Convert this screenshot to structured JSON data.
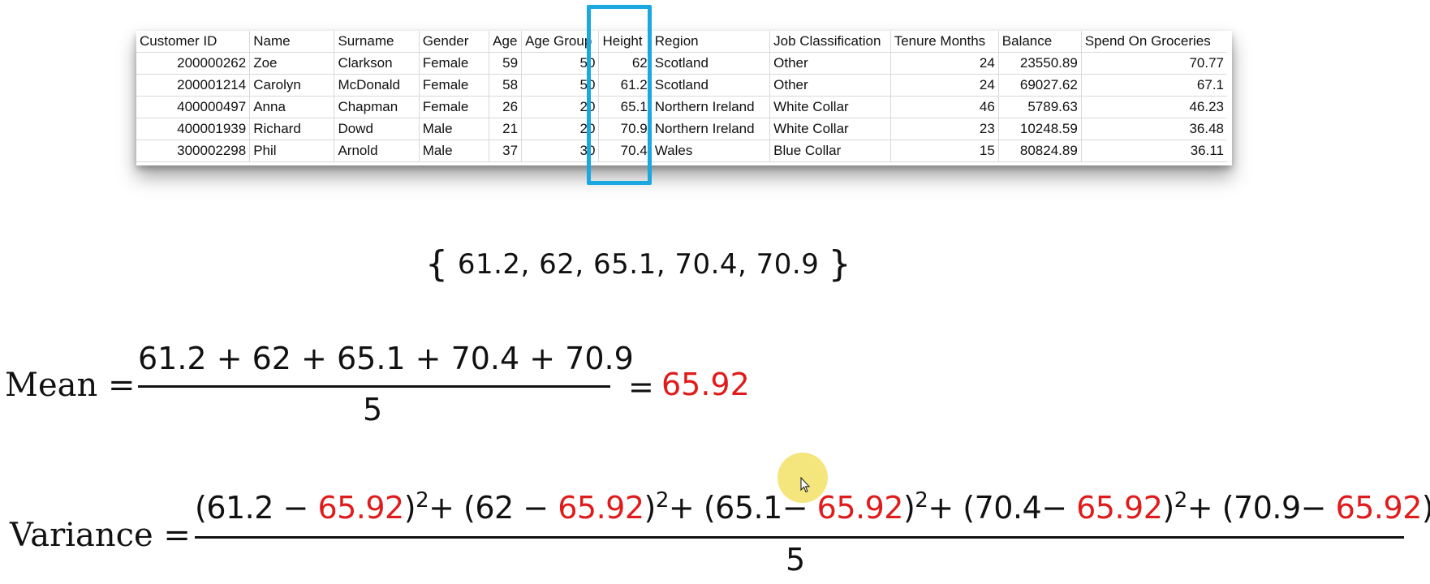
{
  "table": {
    "headers": [
      "Customer ID",
      "Name",
      "Surname",
      "Gender",
      "Age",
      "Age Group",
      "Height",
      "Region",
      "Job Classification",
      "Tenure Months",
      "Balance",
      "Spend On Groceries"
    ],
    "rows": [
      [
        "200000262",
        "Zoe",
        "Clarkson",
        "Female",
        "59",
        "50",
        "62",
        "Scotland",
        "Other",
        "24",
        "23550.89",
        "70.77"
      ],
      [
        "200001214",
        "Carolyn",
        "McDonald",
        "Female",
        "58",
        "50",
        "61.2",
        "Scotland",
        "Other",
        "24",
        "69027.62",
        "67.1"
      ],
      [
        "400000497",
        "Anna",
        "Chapman",
        "Female",
        "26",
        "20",
        "65.1",
        "Northern Ireland",
        "White Collar",
        "46",
        "5789.63",
        "46.23"
      ],
      [
        "400001939",
        "Richard",
        "Dowd",
        "Male",
        "21",
        "20",
        "70.9",
        "Northern Ireland",
        "White Collar",
        "23",
        "10248.59",
        "36.48"
      ],
      [
        "300002298",
        "Phil",
        "Arnold",
        "Male",
        "37",
        "30",
        "70.4",
        "Wales",
        "Blue Collar",
        "15",
        "80824.89",
        "36.11"
      ]
    ]
  },
  "set": {
    "open": "{",
    "values": "61.2, 62, 65.1, 70.4, 70.9",
    "close": "}"
  },
  "mean": {
    "label": "Mean =",
    "numerator": "61.2 + 62 + 65.1 + 70.4 + 70.9",
    "denominator": "5",
    "equals": "=",
    "result": "65.92"
  },
  "variance": {
    "label": "Variance =",
    "terms": [
      {
        "open": "(61.2 − ",
        "mean": "65.92",
        "close": ")",
        "sep": "+ "
      },
      {
        "open": "(62 − ",
        "mean": "65.92",
        "close": ")",
        "sep": "+ "
      },
      {
        "open": "(65.1− ",
        "mean": "65.92",
        "close": ")",
        "sep": "+ "
      },
      {
        "open": "(70.4− ",
        "mean": "65.92",
        "close": ")",
        "sep": "+ "
      },
      {
        "open": "(70.9− ",
        "mean": "65.92",
        "close": ")",
        "sep": ""
      }
    ],
    "exponent": "2",
    "denominator": "5"
  },
  "colors": {
    "highlight": "#1ba8e0",
    "mean_value": "#e01b1b"
  }
}
